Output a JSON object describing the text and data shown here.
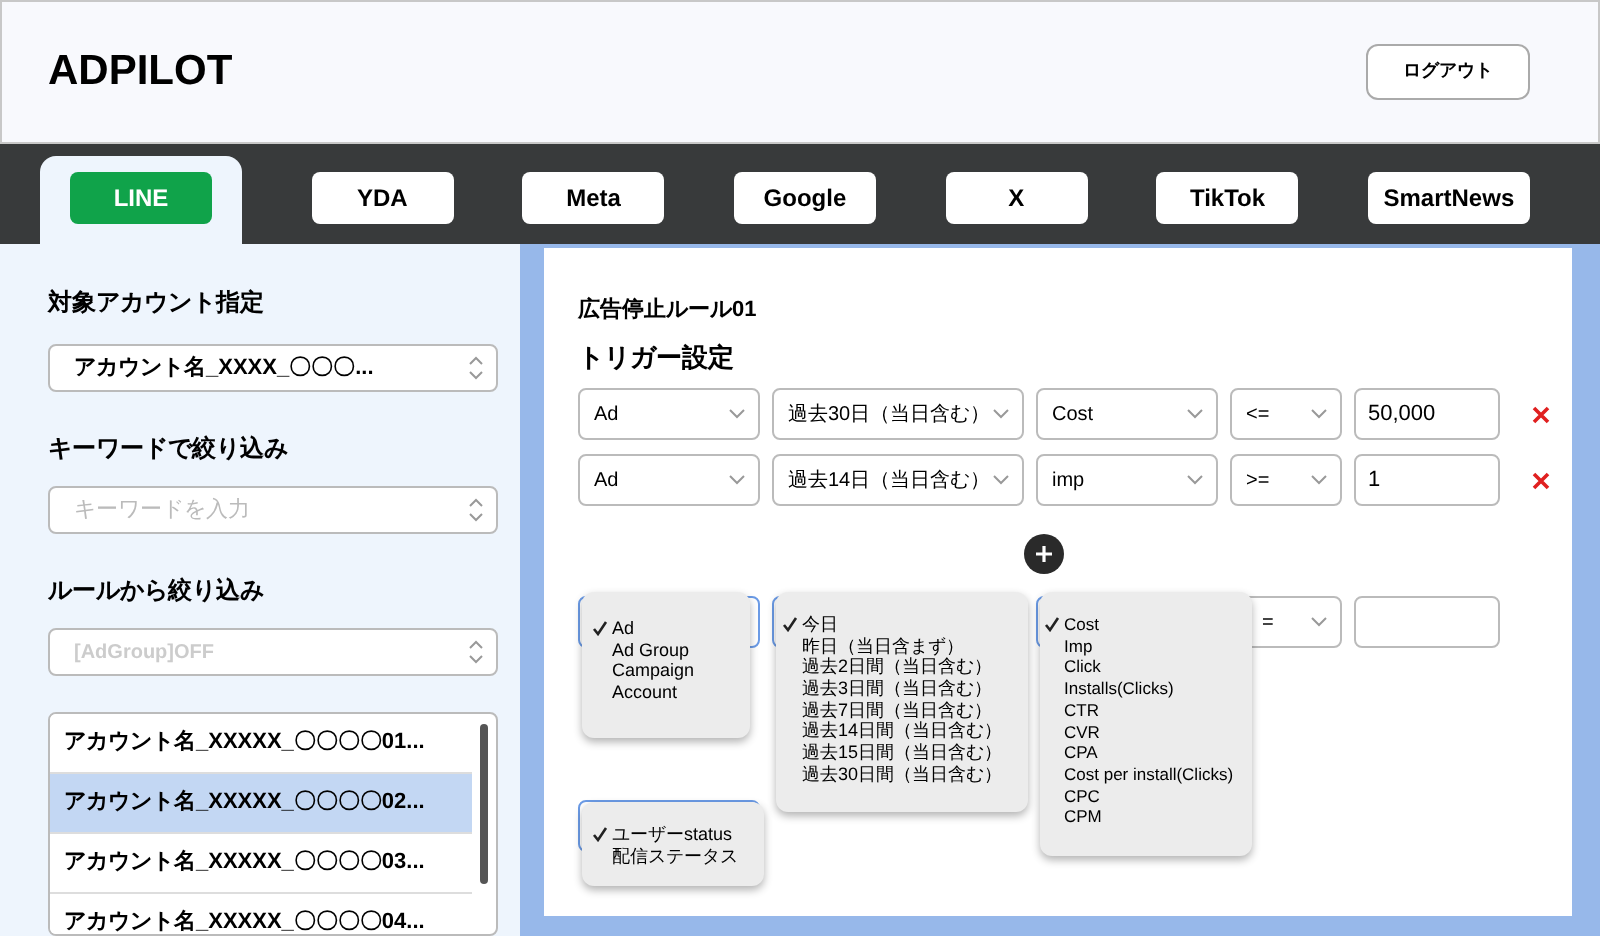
{
  "header": {
    "title": "ADPILOT",
    "logout": "ログアウト"
  },
  "tabs": [
    {
      "label": "LINE",
      "selected": true
    },
    {
      "label": "YDA",
      "selected": false
    },
    {
      "label": "Meta",
      "selected": false
    },
    {
      "label": "Google",
      "selected": false
    },
    {
      "label": "X",
      "selected": false
    },
    {
      "label": "TikTok",
      "selected": false
    },
    {
      "label": "SmartNews",
      "selected": false
    }
  ],
  "sidebar": {
    "account_label": "対象アカウント指定",
    "account_value": "アカウント名_XXXX_〇〇〇...",
    "keyword_label": "キーワードで絞り込み",
    "keyword_placeholder": "キーワードを入力",
    "rule_label": "ルールから絞り込み",
    "rule_placeholder": "[AdGroup]OFF",
    "accounts": [
      {
        "label": "アカウント名_XXXXX_〇〇〇〇01...",
        "selected": false
      },
      {
        "label": "アカウント名_XXXXX_〇〇〇〇02...",
        "selected": true
      },
      {
        "label": "アカウント名_XXXXX_〇〇〇〇03...",
        "selected": false
      },
      {
        "label": "アカウント名_XXXXX_〇〇〇〇04...",
        "selected": false
      }
    ]
  },
  "rule": {
    "title": "広告停止ルール01",
    "trigger_title": "トリガー設定",
    "conditions": [
      {
        "target": "Ad",
        "period": "過去30日（当日含む）",
        "metric": "Cost",
        "operator": "<=",
        "value": "50,000"
      },
      {
        "target": "Ad",
        "period": "過去14日（当日含む）",
        "metric": "imp",
        "operator": ">=",
        "value": "1"
      }
    ],
    "new_condition": {
      "operator": "="
    },
    "menus": [
      {
        "options": [
          {
            "label": "Ad",
            "checked": true
          },
          {
            "label": "Ad Group",
            "checked": false
          },
          {
            "label": "Campaign",
            "checked": false
          },
          {
            "label": "Account",
            "checked": false
          }
        ]
      },
      {
        "options": [
          {
            "label": "今日",
            "checked": true
          },
          {
            "label": "昨日（当日含まず）",
            "checked": false
          },
          {
            "label": "過去2日間（当日含む）",
            "checked": false
          },
          {
            "label": "過去3日間（当日含む）",
            "checked": false
          },
          {
            "label": "過去7日間（当日含む）",
            "checked": false
          },
          {
            "label": "過去14日間（当日含む）",
            "checked": false
          },
          {
            "label": "過去15日間（当日含む）",
            "checked": false
          },
          {
            "label": "過去30日間（当日含む）",
            "checked": false
          }
        ]
      },
      {
        "options": [
          {
            "label": "Cost",
            "checked": true
          },
          {
            "label": "Imp",
            "checked": false
          },
          {
            "label": "Click",
            "checked": false
          },
          {
            "label": "Installs(Clicks)",
            "checked": false
          },
          {
            "label": "CTR",
            "checked": false
          },
          {
            "label": "CVR",
            "checked": false
          },
          {
            "label": "CPA",
            "checked": false
          },
          {
            "label": "Cost per install(Clicks)",
            "checked": false
          },
          {
            "label": "CPC",
            "checked": false
          },
          {
            "label": "CPM",
            "checked": false
          }
        ]
      },
      {
        "options": [
          {
            "label": "ユーザーstatus",
            "checked": true
          },
          {
            "label": "配信ステータス",
            "checked": false
          }
        ]
      }
    ]
  }
}
